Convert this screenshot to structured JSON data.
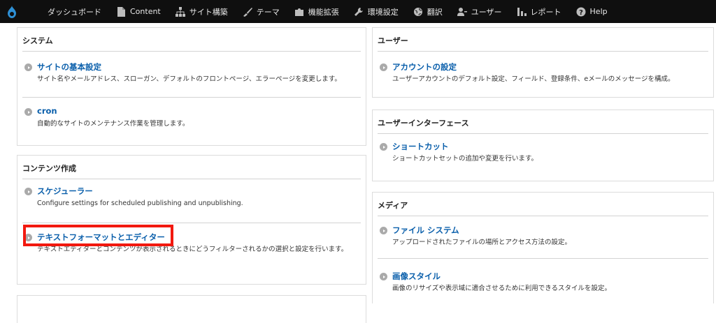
{
  "toolbar": {
    "items": [
      {
        "label": "ダッシュボード",
        "icon": "none"
      },
      {
        "label": "Content",
        "icon": "file-icon"
      },
      {
        "label": "サイト構築",
        "icon": "sitemap-icon"
      },
      {
        "label": "テーマ",
        "icon": "brush-icon"
      },
      {
        "label": "機能拡張",
        "icon": "puzzle-icon"
      },
      {
        "label": "環境設定",
        "icon": "wrench-icon"
      },
      {
        "label": "翻訳",
        "icon": "globe-icon"
      },
      {
        "label": "ユーザー",
        "icon": "people-icon"
      },
      {
        "label": "レポート",
        "icon": "bar-chart-icon"
      },
      {
        "label": "Help",
        "icon": "help-icon"
      }
    ]
  },
  "panels": {
    "system": {
      "title": "システム",
      "items": [
        {
          "link": "サイトの基本設定",
          "desc": "サイト名やメールアドレス、スローガン、デフォルトのフロントページ、エラーページを変更します。"
        },
        {
          "link": "cron",
          "desc": "自動的なサイトのメンテナンス作業を管理します。"
        }
      ]
    },
    "content": {
      "title": "コンテンツ作成",
      "items": [
        {
          "link": "スケジューラー",
          "desc": "Configure settings for scheduled publishing and unpublishing."
        },
        {
          "link": "テキストフォーマットとエディター",
          "desc": "テキストエディターとコンテンツが表示されるときにどうフィルターされるかの選択と設定を行います。"
        }
      ]
    },
    "user": {
      "title": "ユーザー",
      "items": [
        {
          "link": "アカウントの設定",
          "desc": "ユーザーアカウントのデフォルト設定、フィールド、登録条件、eメールのメッセージを構成。"
        }
      ]
    },
    "ui": {
      "title": "ユーザーインターフェース",
      "items": [
        {
          "link": "ショートカット",
          "desc": "ショートカットセットの追加や変更を行います。"
        }
      ]
    },
    "media": {
      "title": "メディア",
      "items": [
        {
          "link": "ファイル システム",
          "desc": "アップロードされたファイルの場所とアクセス方法の設定。"
        },
        {
          "link": "画像スタイル",
          "desc": "画像のリサイズや表示域に適合させるために利用できるスタイルを設定。"
        }
      ]
    }
  },
  "colors": {
    "link": "#0a5fab",
    "highlight": "#f2190f",
    "toolbar": "#0f0f0f"
  }
}
